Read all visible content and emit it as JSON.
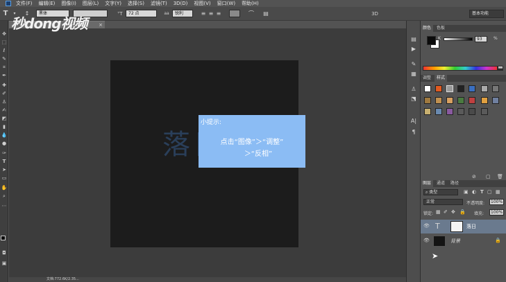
{
  "menubar": {
    "items": [
      "文件(F)",
      "编辑(E)",
      "图像(I)",
      "图层(L)",
      "文字(Y)",
      "选择(S)",
      "滤镜(T)",
      "3D(D)",
      "视图(V)",
      "窗口(W)",
      "帮助(H)"
    ]
  },
  "options": {
    "font_family": "黑体",
    "font_size": "72 点",
    "antialias": "锐利",
    "label_3d": "3D",
    "workspace": "基本功能"
  },
  "logo": {
    "text": "秒dong视频"
  },
  "document": {
    "tab_title": "@...",
    "canvas_faint_text": "落日",
    "status_text": "文档:772.6K/2.35..."
  },
  "tip": {
    "title": "小提示:",
    "line1": "点击“图像”＞“调整”",
    "line2": "＞“反相”"
  },
  "color_panel": {
    "tabs": [
      "颜色",
      "色板"
    ],
    "channel_label": "K",
    "value": "93",
    "unit": "%",
    "fg_color": "#0b0b0b",
    "bg_color": "#ffffff"
  },
  "styles_panel": {
    "tabs": [
      "调整",
      "样式"
    ]
  },
  "layers_panel": {
    "tabs": [
      "图层",
      "通道",
      "路径"
    ],
    "filter_kind": "类型",
    "blend_mode": "正常",
    "opacity_label": "不透明度:",
    "opacity_value": "100%",
    "lock_label": "锁定:",
    "fill_label": "填充:",
    "fill_value": "100%",
    "layers": [
      {
        "name": "落日",
        "type_label": "T"
      },
      {
        "name": "背景"
      }
    ]
  },
  "colors": {
    "accent_tip": "#8bbcf4",
    "canvas": "#1c1c1c"
  }
}
